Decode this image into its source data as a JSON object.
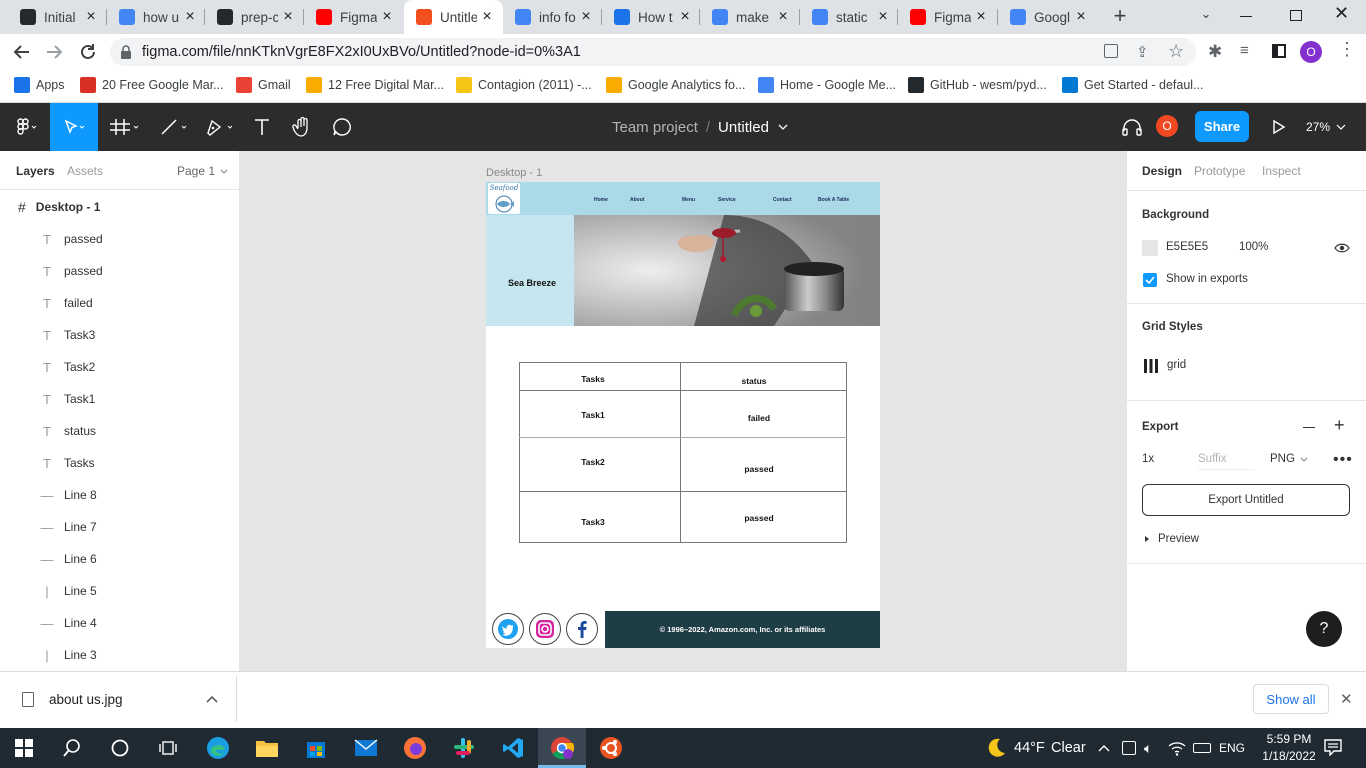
{
  "browser": {
    "tabs": [
      {
        "label": "Initial",
        "icon": "github-icon",
        "color": "#24292e"
      },
      {
        "label": "how u",
        "icon": "google-icon",
        "color": "#4285f4"
      },
      {
        "label": "prep-c",
        "icon": "github-icon",
        "color": "#24292e"
      },
      {
        "label": "Figma",
        "icon": "youtube-icon",
        "color": "#ff0000"
      },
      {
        "label": "Untitle",
        "icon": "figma-icon",
        "color": "#f24e1e",
        "active": true
      },
      {
        "label": "info fo",
        "icon": "google-icon",
        "color": "#4285f4"
      },
      {
        "label": "How t",
        "icon": "123-icon",
        "color": "#1a73e8"
      },
      {
        "label": "make",
        "icon": "google-icon",
        "color": "#4285f4"
      },
      {
        "label": "static",
        "icon": "google-icon",
        "color": "#4285f4"
      },
      {
        "label": "Figma",
        "icon": "youtube-icon",
        "color": "#ff0000"
      },
      {
        "label": "Googl",
        "icon": "translate-icon",
        "color": "#4285f4"
      }
    ],
    "url": "figma.com/file/nnKTknVgrE8FX2xI0UxBVo/Untitled?node-id=0%3A1",
    "profile_initial": "O",
    "bookmarks": [
      {
        "label": "Apps",
        "color": "#1a73e8"
      },
      {
        "label": "20 Free Google Mar...",
        "color": "#d93025"
      },
      {
        "label": "Gmail",
        "color": "#ea4335"
      },
      {
        "label": "12 Free Digital Mar...",
        "color": "#f9ab00"
      },
      {
        "label": "Contagion (2011) -...",
        "color": "#f5c518"
      },
      {
        "label": "Google Analytics fo...",
        "color": "#f9ab00"
      },
      {
        "label": "Home - Google Me...",
        "color": "#4285f4"
      },
      {
        "label": "GitHub - wesm/pyd...",
        "color": "#24292e"
      },
      {
        "label": "Get Started - defaul...",
        "color": "#0078d4"
      }
    ]
  },
  "figma": {
    "breadcrumb_team": "Team project",
    "breadcrumb_sep": "/",
    "file_name": "Untitled",
    "avatar_initial": "O",
    "share_label": "Share",
    "zoom": "27%",
    "accent": "#0d99ff",
    "left_tabs": {
      "layers": "Layers",
      "assets": "Assets",
      "page": "Page 1"
    },
    "frame_layer": "Desktop - 1",
    "layers": [
      {
        "name": "passed",
        "type": "text"
      },
      {
        "name": "passed",
        "type": "text"
      },
      {
        "name": "failed",
        "type": "text"
      },
      {
        "name": "Task3",
        "type": "text"
      },
      {
        "name": "Task2",
        "type": "text"
      },
      {
        "name": "Task1",
        "type": "text"
      },
      {
        "name": "status",
        "type": "text"
      },
      {
        "name": "Tasks",
        "type": "text"
      },
      {
        "name": "Line 8",
        "type": "hline"
      },
      {
        "name": "Line 7",
        "type": "hline"
      },
      {
        "name": "Line 6",
        "type": "hline"
      },
      {
        "name": "Line 5",
        "type": "vline"
      },
      {
        "name": "Line 4",
        "type": "hline"
      },
      {
        "name": "Line 3",
        "type": "vline"
      }
    ],
    "right_tabs": {
      "design": "Design",
      "prototype": "Prototype",
      "inspect": "Inspect"
    },
    "background": {
      "title": "Background",
      "hex": "E5E5E5",
      "opacity": "100%",
      "show_in_exports": "Show in exports"
    },
    "grid": {
      "title": "Grid Styles",
      "name": "grid"
    },
    "export": {
      "title": "Export",
      "scale": "1x",
      "suffix_placeholder": "Suffix",
      "format": "PNG",
      "button": "Export Untitled",
      "preview": "Preview"
    },
    "help": "?"
  },
  "design": {
    "frame_label": "Desktop - 1",
    "logo_text": "Seafood",
    "nav": [
      "Home",
      "About",
      "Menu",
      "Service",
      "Contact",
      "Book A Table"
    ],
    "hero_title": "Sea Breeze",
    "table": {
      "headers": [
        "Tasks",
        "status"
      ],
      "rows": [
        [
          "Task1",
          "failed"
        ],
        [
          "Task2",
          "passed"
        ],
        [
          "Task3",
          "passed"
        ]
      ]
    },
    "footer": "© 1996–2022, Amazon.com, Inc. or its affiliates"
  },
  "downloads": {
    "file": "about us.jpg",
    "show_all": "Show all"
  },
  "taskbar": {
    "weather_temp": "44°F",
    "weather_cond": "Clear",
    "lang": "ENG",
    "time": "5:59 PM",
    "date": "1/18/2022"
  }
}
